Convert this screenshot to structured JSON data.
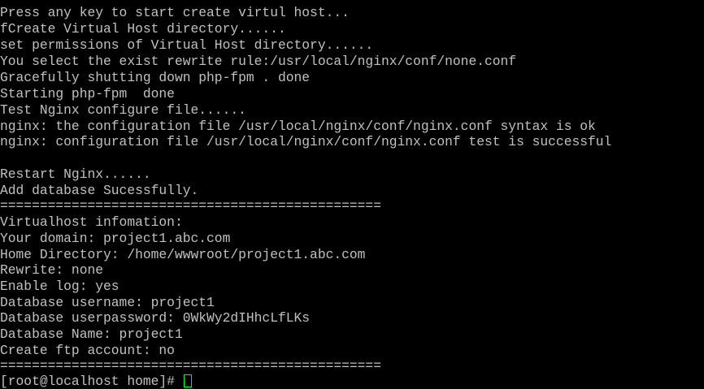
{
  "terminal": {
    "colors": {
      "background": "#000000",
      "text": "#c0c0c0",
      "cursor": "#00ff00"
    },
    "lines": [
      "Press any key to start create virtul host...",
      "fCreate Virtual Host directory......",
      "set permissions of Virtual Host directory......",
      "You select the exist rewrite rule:/usr/local/nginx/conf/none.conf",
      "Gracefully shutting down php-fpm . done",
      "Starting php-fpm  done",
      "Test Nginx configure file......",
      "nginx: the configuration file /usr/local/nginx/conf/nginx.conf syntax is ok",
      "nginx: configuration file /usr/local/nginx/conf/nginx.conf test is successful",
      "",
      "Restart Nginx......",
      "Add database Sucessfully.",
      "================================================",
      "Virtualhost infomation:",
      "Your domain: project1.abc.com",
      "Home Directory: /home/wwwroot/project1.abc.com",
      "Rewrite: none",
      "Enable log: yes",
      "Database username: project1",
      "Database userpassword: 0WkWy2dIHhcLfLKs",
      "Database Name: project1",
      "Create ftp account: no",
      "================================================"
    ],
    "prompt": "[root@localhost home]# "
  }
}
